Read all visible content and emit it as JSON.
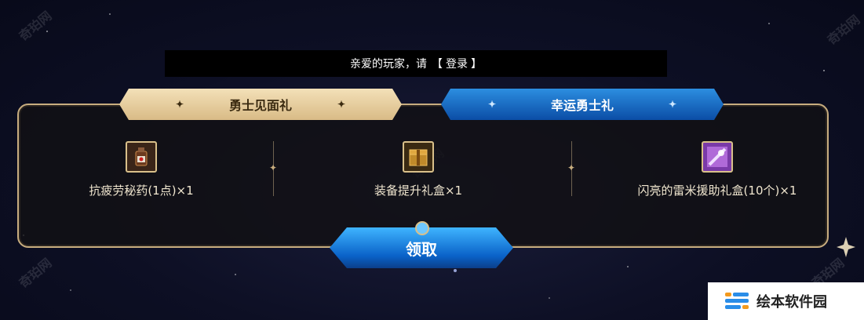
{
  "login": {
    "greeting": "亲爱的玩家，请",
    "bracket_open": "【",
    "link": "登录",
    "bracket_close": "】"
  },
  "tabs": [
    {
      "label": "勇士见面礼",
      "state": "active"
    },
    {
      "label": "幸运勇士礼",
      "state": "inactive"
    }
  ],
  "rewards": [
    {
      "label": "抗疲劳秘药(1点)×1",
      "icon": "potion-icon"
    },
    {
      "label": "装备提升礼盒×1",
      "icon": "equipment-box-icon"
    },
    {
      "label": "闪亮的雷米援助礼盒(10个)×1",
      "icon": "gift-box-icon"
    }
  ],
  "claim": {
    "label": "领取"
  },
  "watermark": {
    "text": "奇珀网"
  },
  "badge": {
    "text": "绘本软件园"
  },
  "colors": {
    "gold_border": "#c8ad7f",
    "active_tab": "#e8d0a0",
    "inactive_tab": "#0b6fd8",
    "claim_button": "#1a86e6"
  }
}
